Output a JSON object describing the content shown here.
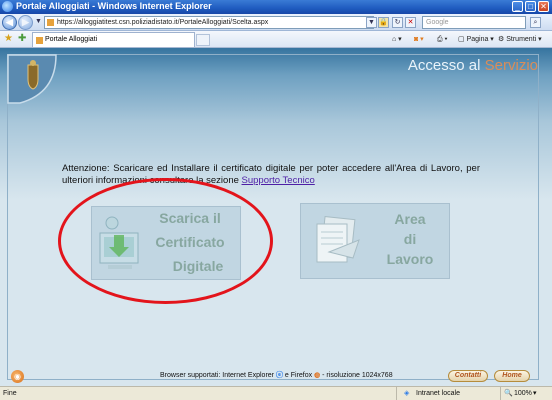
{
  "window": {
    "title": "Portale Alloggiati - Windows Internet Explorer",
    "buttons": {
      "minimize": "_",
      "maximize": "□",
      "close": "✕"
    }
  },
  "addressbar": {
    "url": "https://alloggiatitest.csn.poliziadistato.it/PortaleAlloggiati/Scelta.aspx",
    "search_placeholder": "Google"
  },
  "tabbar": {
    "tab_label": "Portale Alloggiati",
    "pagina_label": "Pagina",
    "strumenti_label": "Strumenti"
  },
  "page": {
    "heading": {
      "word1": "Accesso",
      "word2": "al",
      "word3": "Servizio"
    },
    "notice": "Attenzione: Scaricare ed Installare il certificato digitale per poter accedere all'Area di Lavoro, per ulteriori informazioni consultare la sezione ",
    "notice_link": "Supporto Tecnico",
    "tile_certificate": {
      "line1": "Scarica il",
      "line2": "Certificato",
      "line3": "Digitale"
    },
    "tile_work": {
      "line1": "Area",
      "line2": "di",
      "line3": "Lavoro"
    },
    "footer": {
      "browsers_text": "Browser supportati: Internet Explorer",
      "firefox_text": "e Firefox",
      "resolution_text": "- risoluzione 1024x768",
      "contatti": "Contatti",
      "home": "Home"
    }
  },
  "statusbar": {
    "status": "Fine",
    "zone": "Intranet locale",
    "zoom": "100%"
  }
}
